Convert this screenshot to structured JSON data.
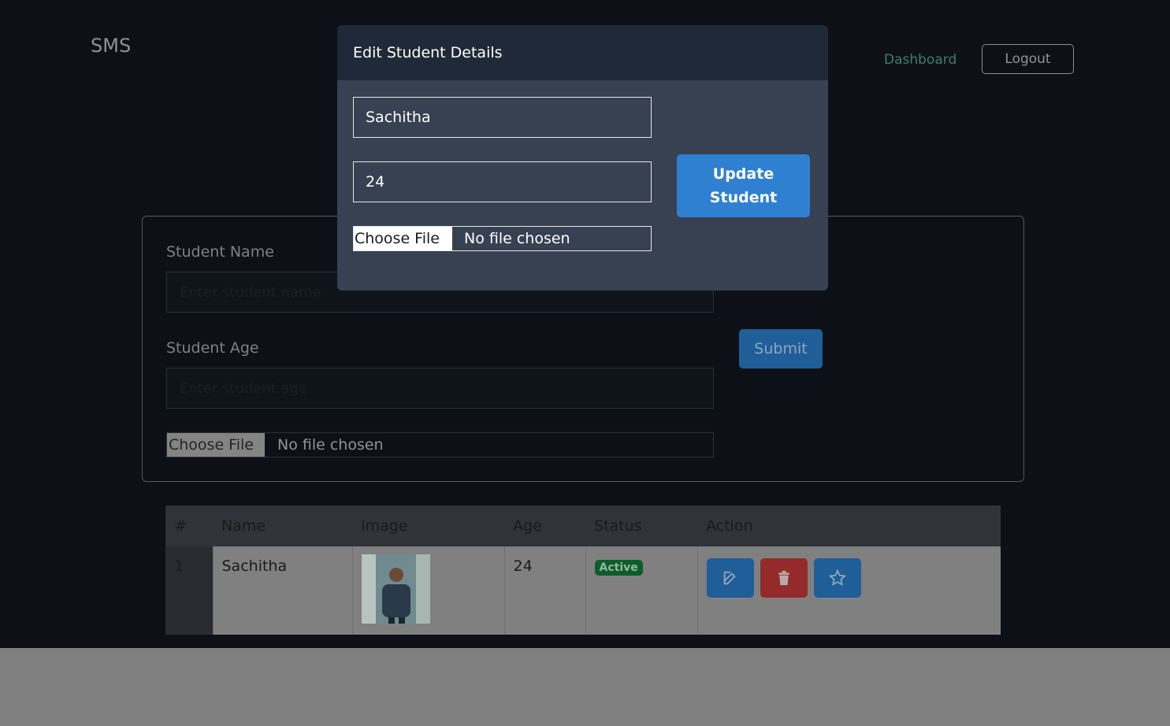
{
  "header": {
    "brand": "SMS",
    "nav_dashboard": "Dashboard",
    "logout_label": "Logout"
  },
  "form": {
    "name_label": "Student Name",
    "name_placeholder": "Enter student name",
    "age_label": "Student Age",
    "age_placeholder": "Enter student age",
    "file_button": "Choose File",
    "file_status": "No file chosen",
    "submit_label": "Submit"
  },
  "table": {
    "headers": [
      "#",
      "Name",
      "Image",
      "Age",
      "Status",
      "Action"
    ],
    "rows": [
      {
        "index": "1",
        "name": "Sachitha",
        "image": "student-photo",
        "age": "24",
        "status": "Active"
      }
    ],
    "actions": [
      "edit-icon",
      "trash-icon",
      "star-icon"
    ]
  },
  "modal": {
    "title": "Edit Student Details",
    "name_value": "Sachitha",
    "age_value": "24",
    "file_button": "Choose File",
    "file_status": "No file chosen",
    "update_line1": "Update",
    "update_line2": "Student"
  },
  "colors": {
    "modal_header": "#1f2937",
    "modal_body": "#374151",
    "update_button": "#2f80d1",
    "status_badge": "#0e5c2e"
  }
}
